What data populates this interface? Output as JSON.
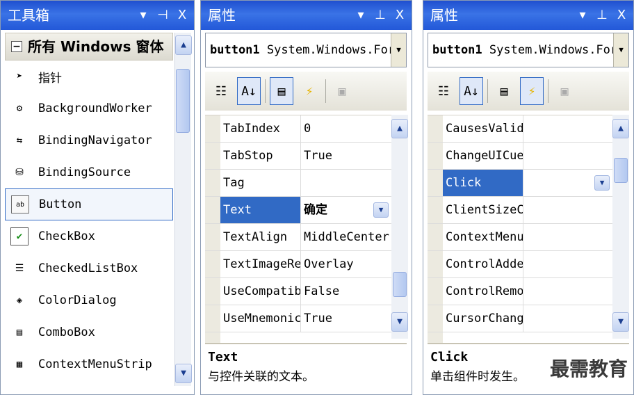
{
  "toolbox": {
    "title": "工具箱",
    "controls": [
      "▾",
      "⊣",
      "X"
    ],
    "category": "所有 Windows 窗体",
    "items": [
      {
        "label": "指针",
        "icon": "pointer-icon",
        "glyph": "➤"
      },
      {
        "label": "BackgroundWorker",
        "icon": "backgroundworker-icon",
        "glyph": "⚙"
      },
      {
        "label": "BindingNavigator",
        "icon": "bindingnavigator-icon",
        "glyph": "⇆"
      },
      {
        "label": "BindingSource",
        "icon": "bindingsource-icon",
        "glyph": "⛁"
      },
      {
        "label": "Button",
        "icon": "button-icon",
        "glyph": "ab",
        "selected": true
      },
      {
        "label": "CheckBox",
        "icon": "checkbox-icon",
        "glyph": "✔"
      },
      {
        "label": "CheckedListBox",
        "icon": "checkedlistbox-icon",
        "glyph": "☰"
      },
      {
        "label": "ColorDialog",
        "icon": "colordialog-icon",
        "glyph": "◈"
      },
      {
        "label": "ComboBox",
        "icon": "combobox-icon",
        "glyph": "▤"
      },
      {
        "label": "ContextMenuStrip",
        "icon": "contextmenustrip-icon",
        "glyph": "▦"
      }
    ]
  },
  "props_left": {
    "title": "属性",
    "controls": [
      "▾",
      "⊥",
      "X"
    ],
    "object_name": "button1",
    "object_type": "System.Windows.For",
    "rows": [
      {
        "name": "TabIndex",
        "value": "0"
      },
      {
        "name": "TabStop",
        "value": "True"
      },
      {
        "name": "Tag",
        "value": ""
      },
      {
        "name": "Text",
        "value": "确定",
        "selected": true,
        "dropdown": true
      },
      {
        "name": "TextAlign",
        "value": "MiddleCenter"
      },
      {
        "name": "TextImageRel",
        "value": "Overlay"
      },
      {
        "name": "UseCompatibl",
        "value": "False"
      },
      {
        "name": "UseMnemonic",
        "value": "True"
      }
    ],
    "desc_title": "Text",
    "desc_text": "与控件关联的文本。"
  },
  "props_right": {
    "title": "属性",
    "controls": [
      "▾",
      "⊥",
      "X"
    ],
    "object_name": "button1",
    "object_type": "System.Windows.For",
    "rows": [
      {
        "name": "CausesValid",
        "value": ""
      },
      {
        "name": "ChangeUICue",
        "value": ""
      },
      {
        "name": "Click",
        "value": "",
        "selected": true,
        "dropdown": true
      },
      {
        "name": "ClientSizeC",
        "value": ""
      },
      {
        "name": "ContextMenu",
        "value": ""
      },
      {
        "name": "ControlAdde",
        "value": ""
      },
      {
        "name": "ControlRemo",
        "value": ""
      },
      {
        "name": "CursorChang",
        "value": ""
      }
    ],
    "desc_title": "Click",
    "desc_text": "单击组件时发生。"
  },
  "watermark": "最需教育",
  "colors": {
    "titlebar": "#2358d8",
    "selection": "#316ac5"
  }
}
